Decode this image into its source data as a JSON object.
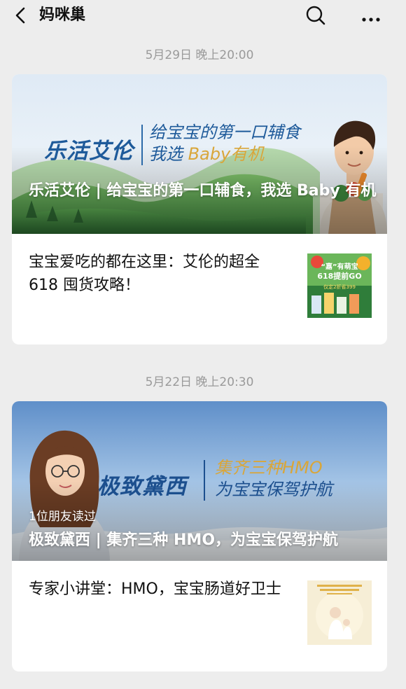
{
  "header": {
    "title": "妈咪巢",
    "back_icon": "chevron-left-icon",
    "search_icon": "search-icon",
    "more_icon": "more-icon"
  },
  "messages": [
    {
      "timestamp": "5月29日 晚上20:00",
      "cover": {
        "brand": "乐活艾伦",
        "slogan_line1": "给宝宝的第一口辅食",
        "slogan_line2_a": "我选 ",
        "slogan_line2_b": "Baby有机",
        "title": "乐活艾伦 | 给宝宝的第一口辅食，我选 Baby 有机"
      },
      "sub_article": {
        "title": "宝宝爱吃的都在这里：艾伦的超全618 囤货攻略！",
        "thumb_text1": "“嘉”有萌宝",
        "thumb_text2": "618提前GO",
        "thumb_text3": "仅定2折省399"
      }
    },
    {
      "timestamp": "5月22日 晚上20:30",
      "cover": {
        "brand": "极致黛西",
        "slogan_line1": "集齐三种HMO",
        "slogan_line2": "为宝宝保驾护航",
        "friends_read": "1位朋友读过",
        "title": "极致黛西 | 集齐三种 HMO，为宝宝保驾护航"
      },
      "sub_article": {
        "title": "专家小讲堂：HMO，宝宝肠道好卫士"
      }
    }
  ],
  "colors": {
    "background": "#ededed",
    "card": "#ffffff",
    "timestamp": "#9a9a9a",
    "brand_blue": "#1e5a9a",
    "gold": "#d9a63a"
  }
}
